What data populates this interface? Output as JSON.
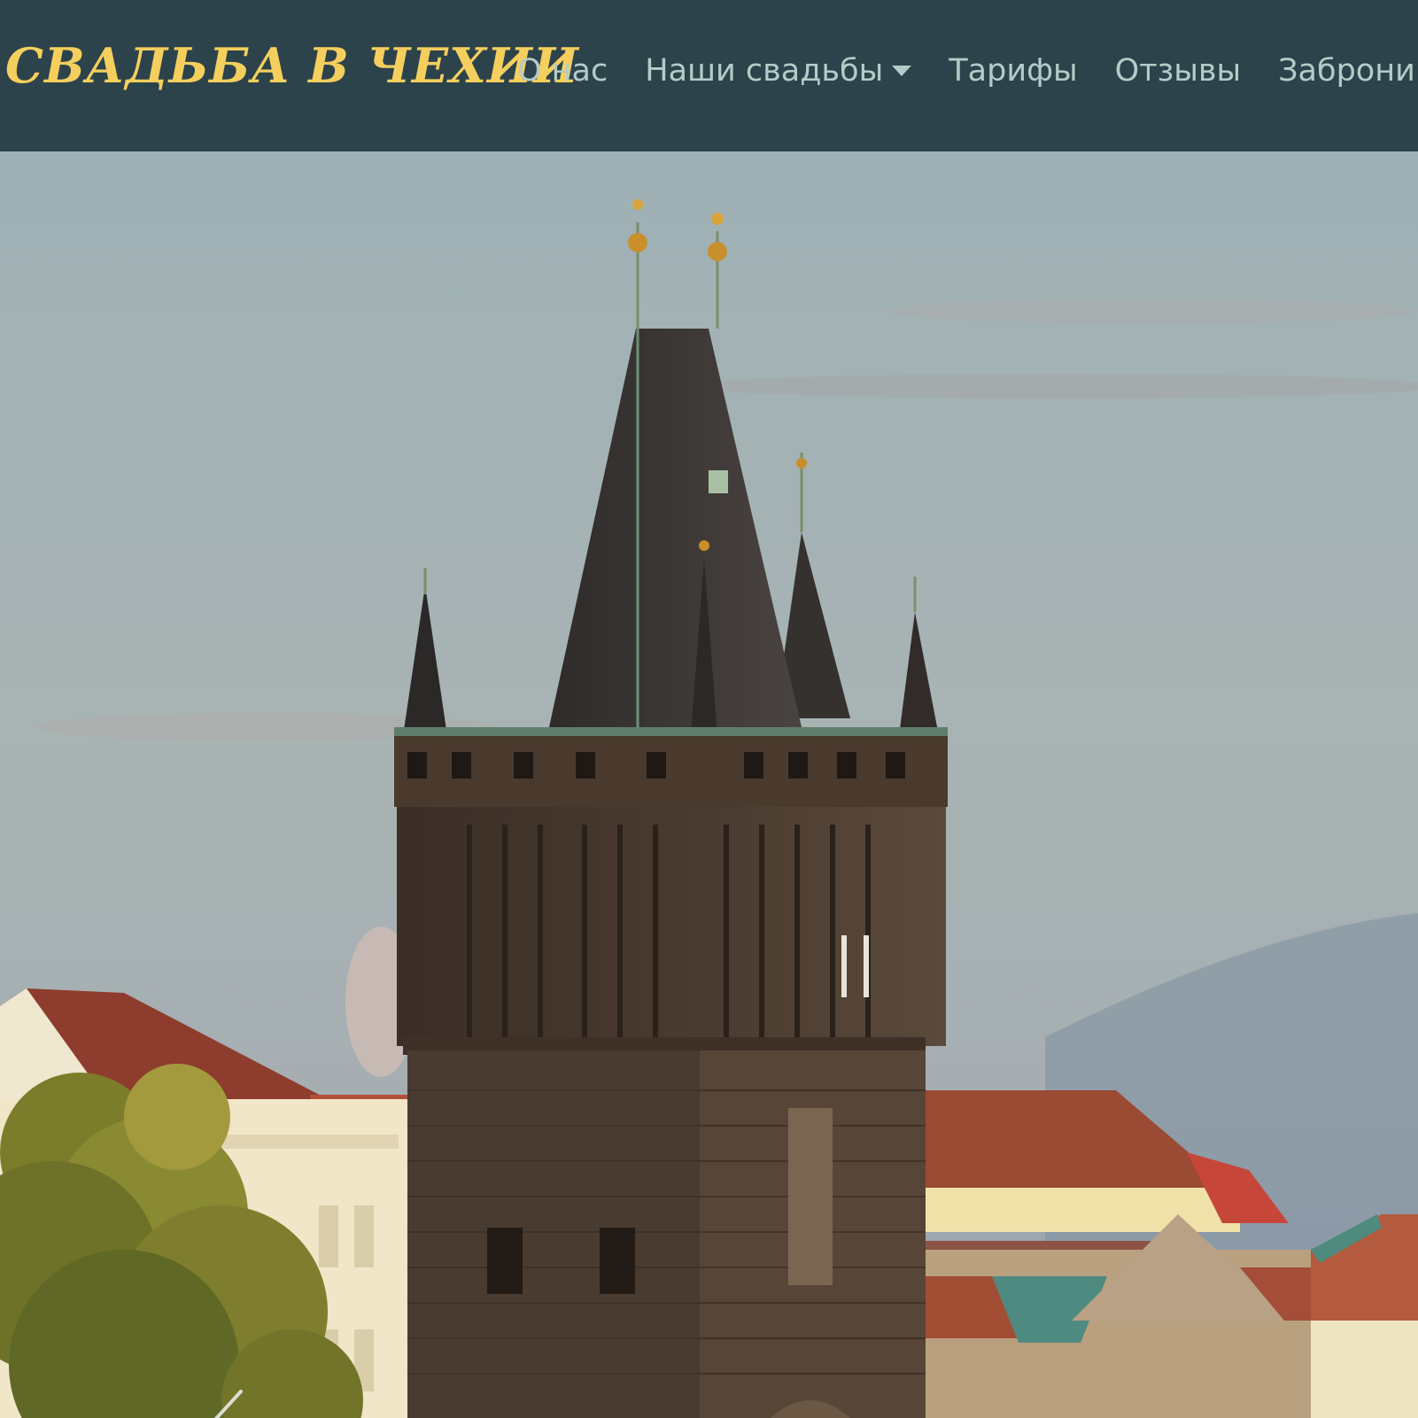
{
  "brand": {
    "title": "СВАДЬБА В ЧЕХИИ"
  },
  "nav": {
    "items": [
      {
        "label": "О нас"
      },
      {
        "label": "Наши свадьбы",
        "has_dropdown": true
      },
      {
        "label": "Тарифы"
      },
      {
        "label": "Отзывы"
      },
      {
        "label": "Забронир"
      }
    ]
  },
  "colors": {
    "navbar_bg": "#2d434b",
    "brand": "#f5cf5d",
    "nav_link": "#b5cbc7"
  },
  "carousel": {
    "prev_icon": "chevron-left-icon"
  }
}
